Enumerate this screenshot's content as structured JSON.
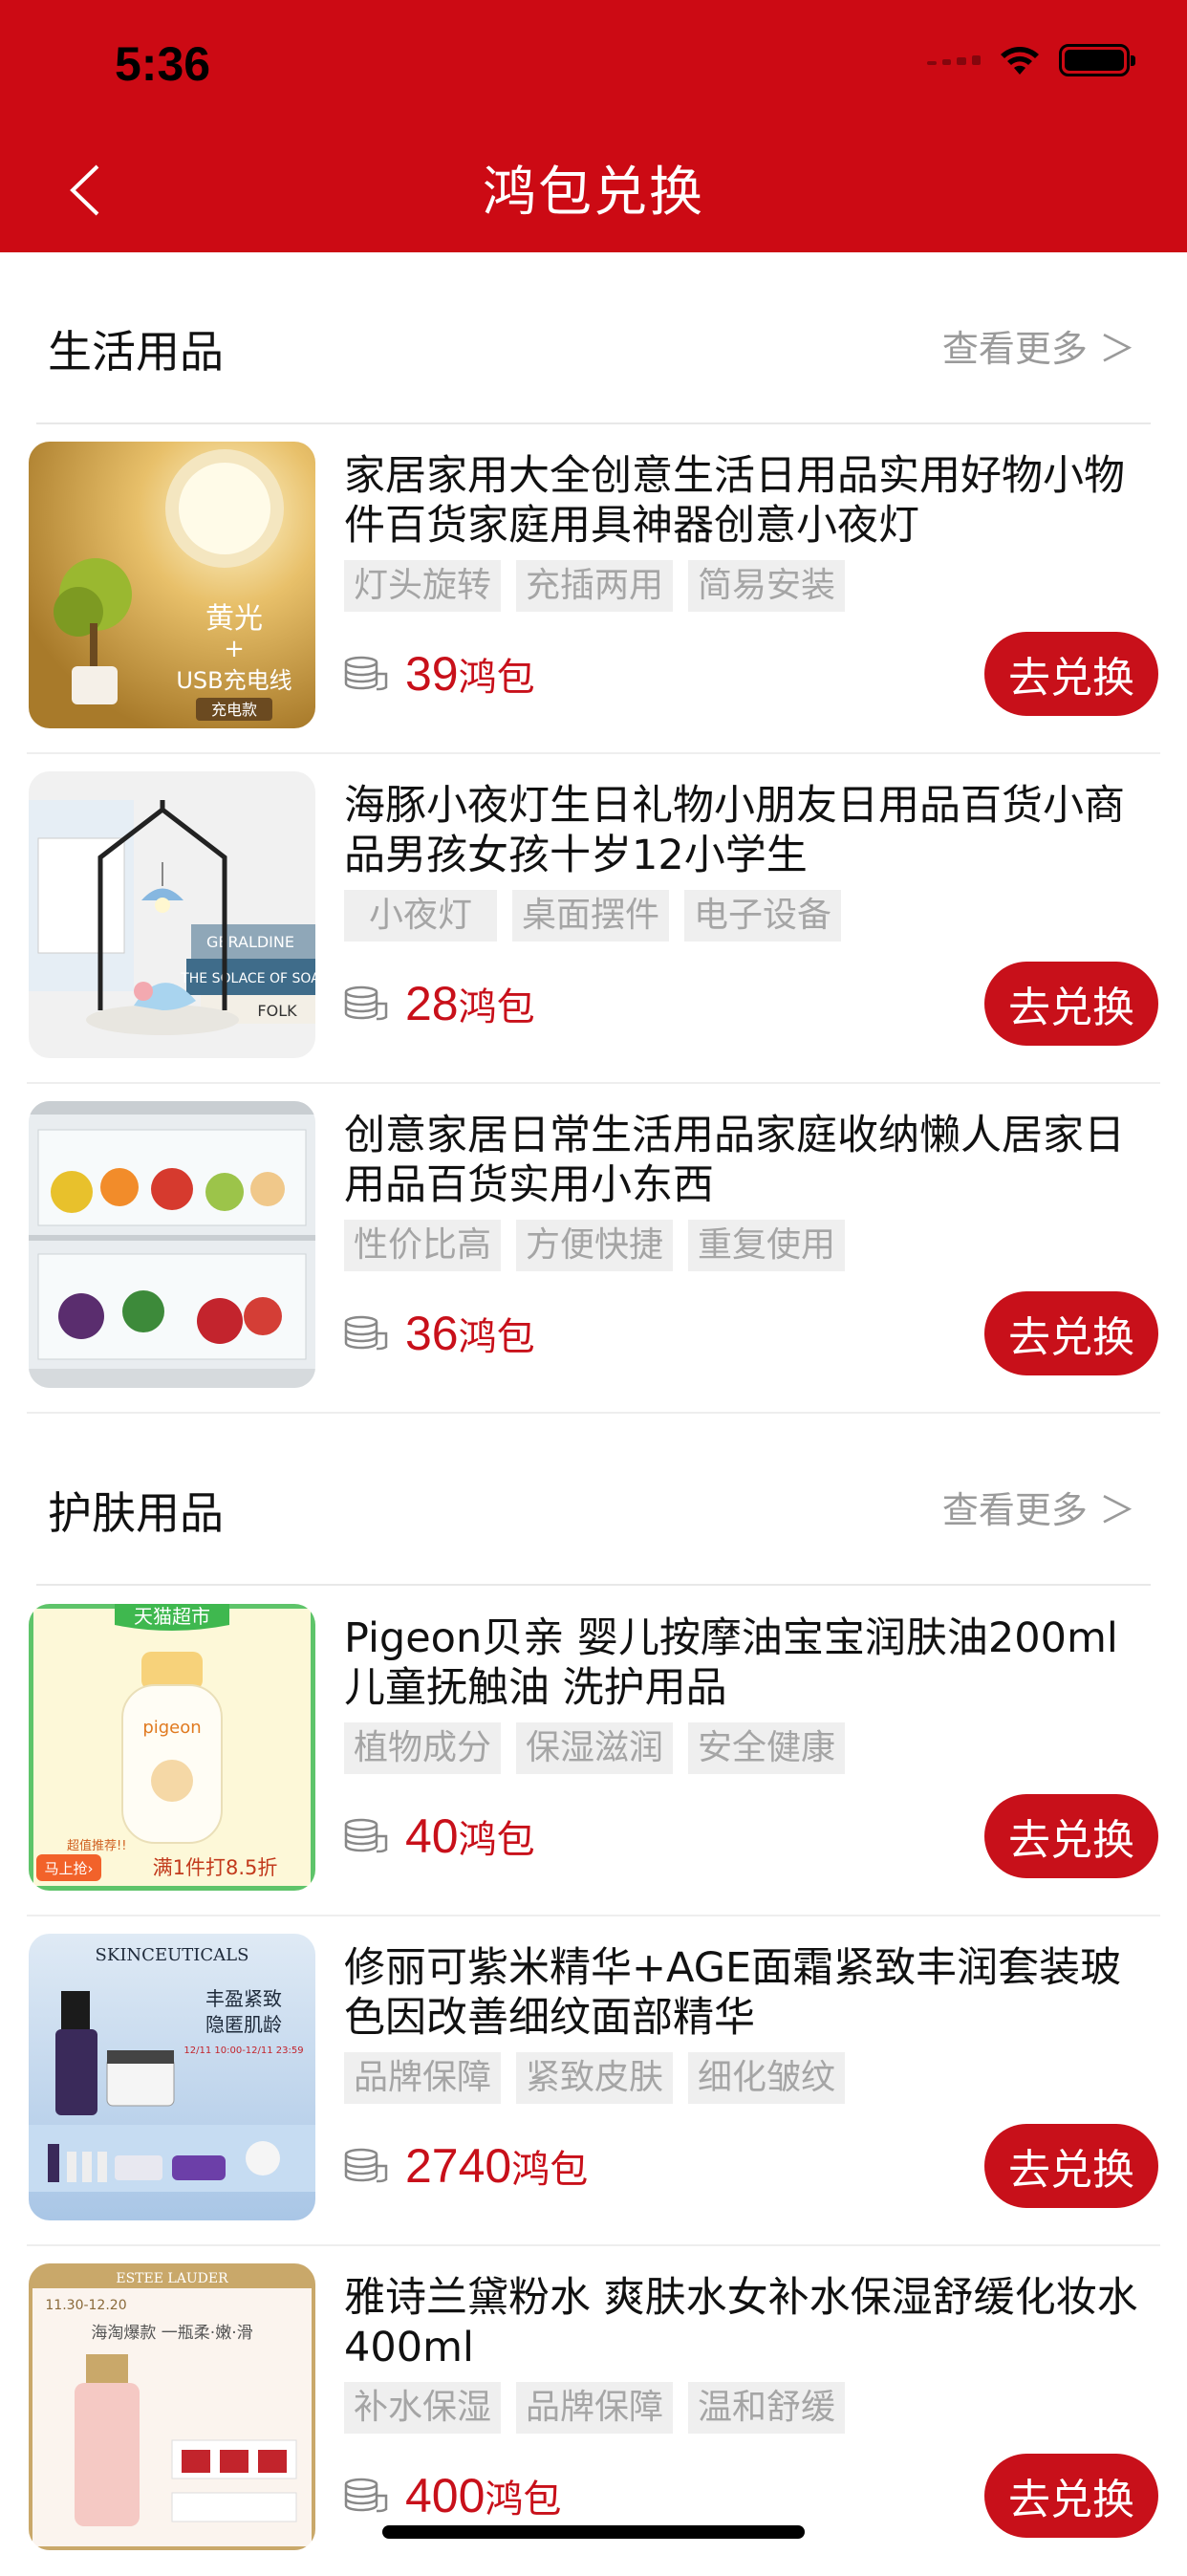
{
  "status_bar": {
    "time": "5:36"
  },
  "nav": {
    "title": "鸿包兑换"
  },
  "sections": [
    {
      "title": "生活用品",
      "more": "查看更多 ＞",
      "items": [
        {
          "title": "家居家用大全创意生活日用品实用好物小物件百货家庭用具神器创意小夜灯",
          "tags": [
            "灯头旋转",
            "充插两用",
            "简易安装"
          ],
          "price": "39",
          "unit": "鸿包",
          "button": "去兑换",
          "thumb_text": {
            "line1": "黄光",
            "line2": "+",
            "line3": "USB充电线",
            "badge": "充电款"
          }
        },
        {
          "title": "海豚小夜灯生日礼物小朋友日用品百货小商品男孩女孩十岁12小学生",
          "tags": [
            "小夜灯",
            "桌面摆件",
            "电子设备"
          ],
          "price": "28",
          "unit": "鸿包",
          "button": "去兑换",
          "thumb_text": {
            "book1": "GERALDINE",
            "book2": "THE SOLACE OF SOA",
            "book3": "FOLK"
          }
        },
        {
          "title": "创意家居日常生活用品家庭收纳懒人居家日用品百货实用小东西",
          "tags": [
            "性价比高",
            "方便快捷",
            "重复使用"
          ],
          "price": "36",
          "unit": "鸿包",
          "button": "去兑换"
        }
      ]
    },
    {
      "title": "护肤用品",
      "more": "查看更多 ＞",
      "items": [
        {
          "title": "Pigeon贝亲 婴儿按摩油宝宝润肤油200ml儿童抚触油 洗护用品",
          "tags": [
            "植物成分",
            "保湿滋润",
            "安全健康"
          ],
          "price": "40",
          "unit": "鸿包",
          "button": "去兑换",
          "thumb_text": {
            "top": "天猫超市",
            "brand": "pigeon",
            "promo": "满1件打8.5折",
            "badge": "马上抢›",
            "small": "超值推荐!!"
          }
        },
        {
          "title": "修丽可紫米精华+AGE面霜紧致丰润套装玻色因改善细纹面部精华",
          "tags": [
            "品牌保障",
            "紧致皮肤",
            "细化皱纹"
          ],
          "price": "2740",
          "unit": "鸿包",
          "button": "去兑换",
          "thumb_text": {
            "brand": "SKINCEUTICALS",
            "line1": "丰盈紧致",
            "line2": "隐匿肌龄",
            "date": "12/11 10:00-12/11 23:59"
          }
        },
        {
          "title": "雅诗兰黛粉水 爽肤水女补水保湿舒缓化妆水400ml",
          "tags": [
            "补水保湿",
            "品牌保障",
            "温和舒缓"
          ],
          "price": "400",
          "unit": "鸿包",
          "button": "去兑换",
          "thumb_text": {
            "brand": "ESTEE LAUDER",
            "date": "11.30-12.20",
            "line1": "海淘爆款 一瓶柔·嫩·滑"
          }
        }
      ]
    }
  ],
  "colors": {
    "brand_red": "#cc0a14",
    "price_red": "#c8101a"
  }
}
